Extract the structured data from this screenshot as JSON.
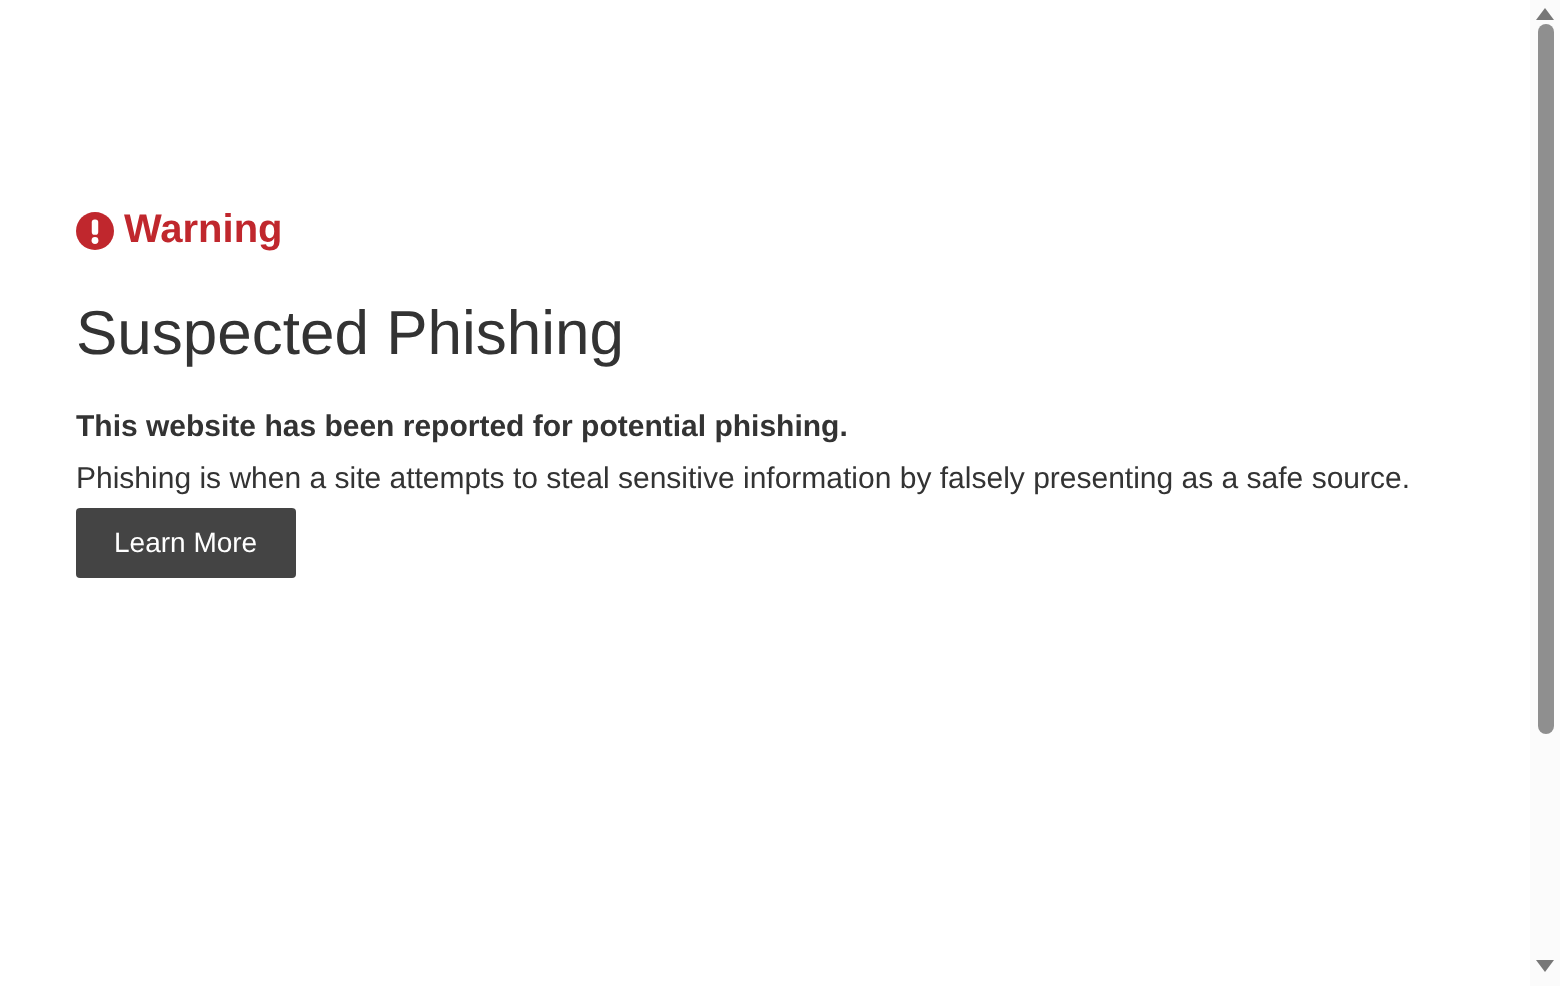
{
  "alert": {
    "label": "Warning"
  },
  "title": "Suspected Phishing",
  "message": {
    "lead": "This website has been reported for potential phishing.",
    "body": "Phishing is when a site attempts to steal sensitive information by falsely presenting as a safe source."
  },
  "buttons": [
    {
      "label": "Learn More"
    }
  ]
}
